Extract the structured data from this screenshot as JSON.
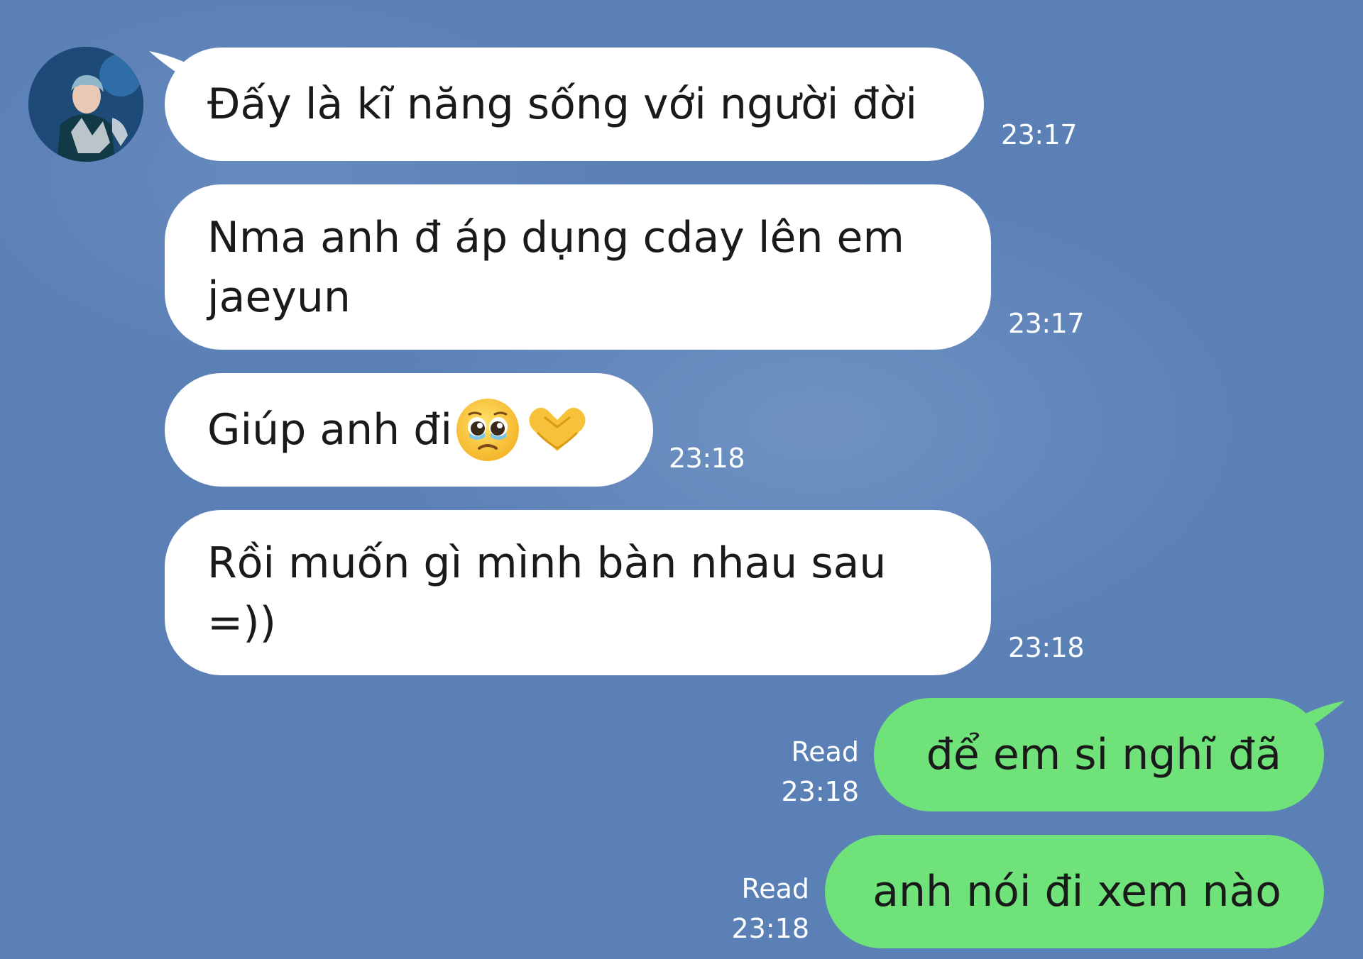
{
  "chat": {
    "incoming": [
      {
        "text": "Đấy là kĩ năng sống với người đời",
        "time": "23:17"
      },
      {
        "text": "Nma anh đ áp dụng cday lên em\njaeyun",
        "time": "23:17"
      },
      {
        "text": "Giúp anh đi",
        "time": "23:18",
        "emoji": [
          "pleading-face-icon",
          "heart-hands-icon"
        ]
      },
      {
        "text": "Rồi muốn gì mình bàn nhau sau\n=))",
        "time": "23:18"
      }
    ],
    "outgoing": [
      {
        "text": "để em si nghĩ đã",
        "status": "Read",
        "time": "23:18"
      },
      {
        "text": "anh nói đi xem nào",
        "status": "Read",
        "time": "23:18"
      }
    ]
  },
  "colors": {
    "background": "#5b80b6",
    "incoming_bubble": "#ffffff",
    "outgoing_bubble": "#6fe27a",
    "meta_text": "#ffffff"
  }
}
